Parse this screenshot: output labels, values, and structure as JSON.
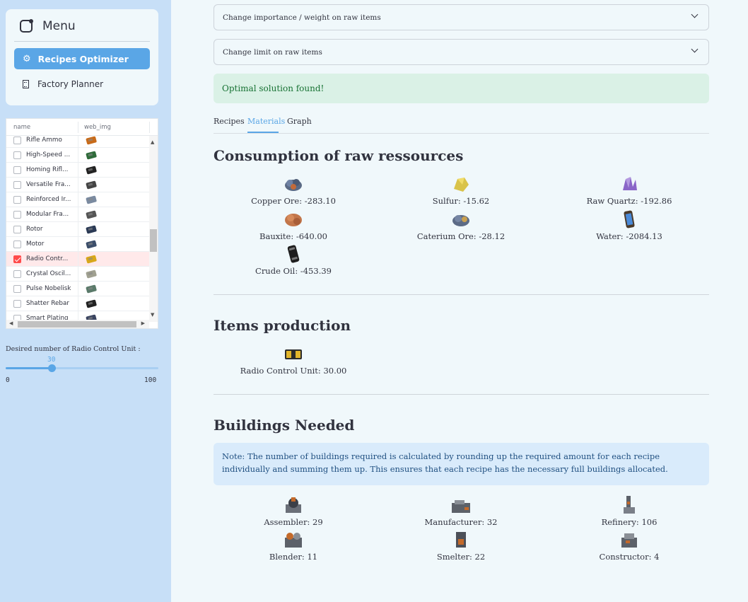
{
  "sidebar": {
    "menu_title": "Menu",
    "nav": [
      {
        "label": "Recipes Optimizer",
        "icon": "gear-icon",
        "active": true
      },
      {
        "label": "Factory Planner",
        "icon": "building-icon",
        "active": false
      }
    ],
    "grid": {
      "columns": [
        "name",
        "web_img"
      ],
      "rows": [
        {
          "name": "Rifle Ammo",
          "checked": false
        },
        {
          "name": "High-Speed ...",
          "checked": false
        },
        {
          "name": "Homing Rifl...",
          "checked": false
        },
        {
          "name": "Versatile Fra...",
          "checked": false
        },
        {
          "name": "Reinforced Ir...",
          "checked": false
        },
        {
          "name": "Modular Fra...",
          "checked": false
        },
        {
          "name": "Rotor",
          "checked": false
        },
        {
          "name": "Motor",
          "checked": false
        },
        {
          "name": "Radio Contr...",
          "checked": true
        },
        {
          "name": "Crystal Oscil...",
          "checked": false
        },
        {
          "name": "Pulse Nobelisk",
          "checked": false
        },
        {
          "name": "Shatter Rebar",
          "checked": false
        },
        {
          "name": "Smart Plating",
          "checked": false
        }
      ]
    },
    "slider": {
      "label": "Desired number of Radio Control Unit :",
      "value": "30",
      "min": "0",
      "max": "100",
      "fraction": 0.3
    }
  },
  "main": {
    "expanders": [
      "Change importance / weight on raw items",
      "Change limit on raw items"
    ],
    "success": "Optimal solution found!",
    "tabs": [
      "Recipes",
      "Materials",
      "Graph"
    ],
    "active_tab": "Materials",
    "raw": {
      "heading": "Consumption of raw ressources",
      "items": [
        "Copper Ore: -283.10",
        "Sulfur: -15.62",
        "Raw Quartz: -192.86",
        "Bauxite: -640.00",
        "Caterium Ore: -28.12",
        "Water: -2084.13",
        "Crude Oil: -453.39"
      ]
    },
    "production": {
      "heading": "Items production",
      "items": [
        "Radio Control Unit: 30.00"
      ]
    },
    "buildings": {
      "heading": "Buildings Needed",
      "note": "Note: The number of buildings required is calculated by rounding up the required amount for each recipe individually and summing them up. This ensures that each recipe has the necessary full buildings allocated.",
      "items": [
        "Assembler: 29",
        "Manufacturer: 32",
        "Refinery: 106",
        "Blender: 11",
        "Smelter: 22",
        "Constructor: 4"
      ]
    }
  },
  "colors": {
    "accent": "#5aa6e6",
    "success_bg": "#daf1e6",
    "info_bg": "#d9ebfb",
    "sidebar_bg": "#c7dff7",
    "checked": "#ff4b4b"
  }
}
